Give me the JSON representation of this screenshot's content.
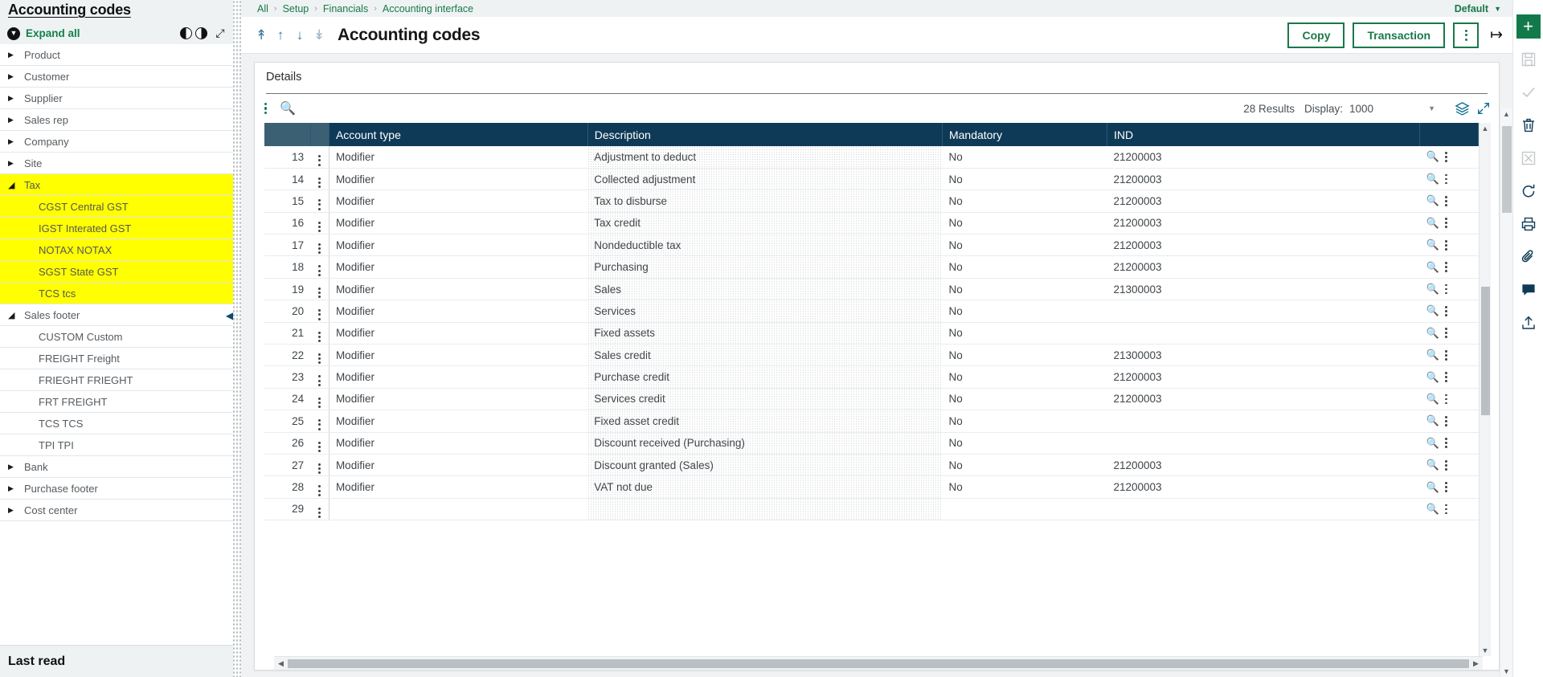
{
  "sidebar": {
    "title": "Accounting codes",
    "expand_all": "Expand all",
    "footer_label": "Last read",
    "items": [
      {
        "label": "Product",
        "state": "closed",
        "child": false,
        "highlight": false
      },
      {
        "label": "Customer",
        "state": "closed",
        "child": false,
        "highlight": false
      },
      {
        "label": "Supplier",
        "state": "closed",
        "child": false,
        "highlight": false
      },
      {
        "label": "Sales rep",
        "state": "closed",
        "child": false,
        "highlight": false
      },
      {
        "label": "Company",
        "state": "closed",
        "child": false,
        "highlight": false
      },
      {
        "label": "Site",
        "state": "closed",
        "child": false,
        "highlight": false
      },
      {
        "label": "Tax",
        "state": "open",
        "child": false,
        "highlight": true
      },
      {
        "label": "CGST Central GST",
        "state": "none",
        "child": true,
        "highlight": true
      },
      {
        "label": "IGST Interated GST",
        "state": "none",
        "child": true,
        "highlight": true
      },
      {
        "label": "NOTAX NOTAX",
        "state": "none",
        "child": true,
        "highlight": true
      },
      {
        "label": "SGST State GST",
        "state": "none",
        "child": true,
        "highlight": true
      },
      {
        "label": "TCS tcs",
        "state": "none",
        "child": true,
        "highlight": true
      },
      {
        "label": "Sales footer",
        "state": "open",
        "child": false,
        "highlight": false
      },
      {
        "label": "CUSTOM Custom",
        "state": "none",
        "child": true,
        "highlight": false
      },
      {
        "label": "FREIGHT Freight",
        "state": "none",
        "child": true,
        "highlight": false
      },
      {
        "label": "FRIEGHT FRIEGHT",
        "state": "none",
        "child": true,
        "highlight": false
      },
      {
        "label": "FRT FREIGHT",
        "state": "none",
        "child": true,
        "highlight": false
      },
      {
        "label": "TCS TCS",
        "state": "none",
        "child": true,
        "highlight": false
      },
      {
        "label": "TPI TPI",
        "state": "none",
        "child": true,
        "highlight": false
      },
      {
        "label": "Bank",
        "state": "closed",
        "child": false,
        "highlight": false
      },
      {
        "label": "Purchase footer",
        "state": "closed",
        "child": false,
        "highlight": false
      },
      {
        "label": "Cost center",
        "state": "closed",
        "child": false,
        "highlight": false
      }
    ],
    "highlight_color": "#ffff00",
    "accent_color": "#11824a"
  },
  "breadcrumb": {
    "crumbs": [
      "All",
      "Setup",
      "Financials",
      "Accounting interface"
    ],
    "separator": "›",
    "right_label": "Default"
  },
  "titlebar": {
    "title": "Accounting codes",
    "nav_icons": [
      "first-record-icon",
      "previous-record-icon",
      "next-record-icon",
      "last-record-icon"
    ],
    "copy_label": "Copy",
    "transaction_label": "Transaction",
    "kebab_icon": "more-options-icon",
    "logout_icon": "logout-icon"
  },
  "panel": {
    "title": "Details",
    "toolbar": {
      "kebab_icon": "grid-options-icon",
      "search_icon": "search-icon",
      "results_text": "28 Results",
      "display_label": "Display:",
      "display_value": "1000",
      "select_caret_icon": "chevron-down-icon",
      "layers_icon": "layers-icon",
      "fullscreen_icon": "expand-icon"
    },
    "columns": [
      "",
      "",
      "Account type",
      "Description",
      "Mandatory",
      "IND",
      ""
    ],
    "rows": [
      {
        "n": "13",
        "type": "Modifier",
        "desc": "Adjustment to deduct",
        "mandatory": "No",
        "ind": "21200003"
      },
      {
        "n": "14",
        "type": "Modifier",
        "desc": "Collected adjustment",
        "mandatory": "No",
        "ind": "21200003"
      },
      {
        "n": "15",
        "type": "Modifier",
        "desc": "Tax to disburse",
        "mandatory": "No",
        "ind": "21200003"
      },
      {
        "n": "16",
        "type": "Modifier",
        "desc": "Tax credit",
        "mandatory": "No",
        "ind": "21200003"
      },
      {
        "n": "17",
        "type": "Modifier",
        "desc": "Nondeductible tax",
        "mandatory": "No",
        "ind": "21200003"
      },
      {
        "n": "18",
        "type": "Modifier",
        "desc": "Purchasing",
        "mandatory": "No",
        "ind": "21200003"
      },
      {
        "n": "19",
        "type": "Modifier",
        "desc": "Sales",
        "mandatory": "No",
        "ind": "21300003"
      },
      {
        "n": "20",
        "type": "Modifier",
        "desc": "Services",
        "mandatory": "No",
        "ind": ""
      },
      {
        "n": "21",
        "type": "Modifier",
        "desc": "Fixed assets",
        "mandatory": "No",
        "ind": ""
      },
      {
        "n": "22",
        "type": "Modifier",
        "desc": "Sales credit",
        "mandatory": "No",
        "ind": "21300003"
      },
      {
        "n": "23",
        "type": "Modifier",
        "desc": "Purchase credit",
        "mandatory": "No",
        "ind": "21200003"
      },
      {
        "n": "24",
        "type": "Modifier",
        "desc": "Services credit",
        "mandatory": "No",
        "ind": "21200003"
      },
      {
        "n": "25",
        "type": "Modifier",
        "desc": "Fixed asset credit",
        "mandatory": "No",
        "ind": ""
      },
      {
        "n": "26",
        "type": "Modifier",
        "desc": "Discount received (Purchasing)",
        "mandatory": "No",
        "ind": ""
      },
      {
        "n": "27",
        "type": "Modifier",
        "desc": "Discount granted (Sales)",
        "mandatory": "No",
        "ind": "21200003"
      },
      {
        "n": "28",
        "type": "Modifier",
        "desc": "VAT not due",
        "mandatory": "No",
        "ind": "21200003"
      },
      {
        "n": "29",
        "type": "",
        "desc": "",
        "mandatory": "",
        "ind": ""
      }
    ]
  },
  "rail": {
    "icons": [
      "new-icon",
      "save-icon",
      "validate-icon",
      "delete-icon",
      "cancel-icon",
      "refresh-icon",
      "print-icon",
      "attach-icon",
      "comment-icon",
      "share-icon"
    ]
  },
  "colors": {
    "header_navy": "#0f3a57",
    "accent_green": "#18794a",
    "highlight_yellow": "#ffff00"
  }
}
